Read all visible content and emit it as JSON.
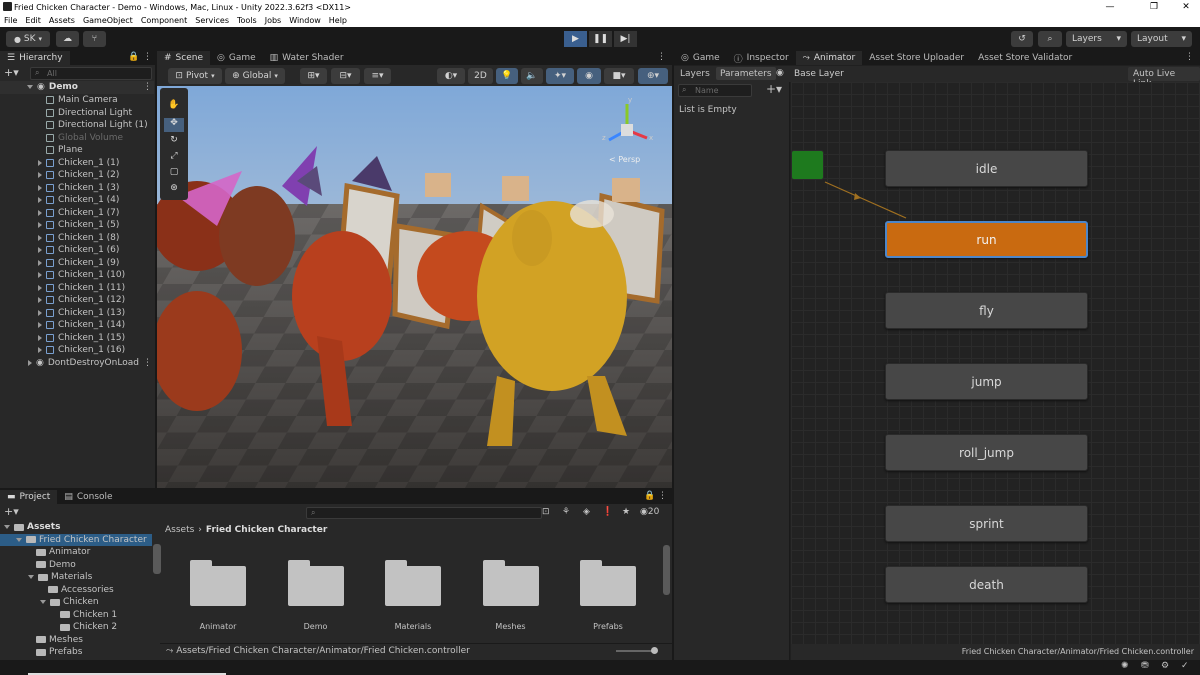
{
  "window": {
    "title": "Fried Chicken Character - Demo - Windows, Mac, Linux - Unity 2022.3.62f3 <DX11>"
  },
  "menu": [
    "File",
    "Edit",
    "Assets",
    "GameObject",
    "Component",
    "Services",
    "Tools",
    "Jobs",
    "Window",
    "Help"
  ],
  "toolbar": {
    "account": "SK",
    "layers": "Layers",
    "layout": "Layout"
  },
  "hierarchy": {
    "tab": "Hierarchy",
    "search_placeholder": "All",
    "scene": "Demo",
    "items": [
      {
        "label": "Main Camera",
        "kind": "object"
      },
      {
        "label": "Directional Light",
        "kind": "object"
      },
      {
        "label": "Directional Light (1)",
        "kind": "object"
      },
      {
        "label": "Global Volume",
        "kind": "disabled"
      },
      {
        "label": "Plane",
        "kind": "object"
      },
      {
        "label": "Chicken_1 (1)",
        "kind": "prefab"
      },
      {
        "label": "Chicken_1 (2)",
        "kind": "prefab"
      },
      {
        "label": "Chicken_1 (3)",
        "kind": "prefab"
      },
      {
        "label": "Chicken_1 (4)",
        "kind": "prefab"
      },
      {
        "label": "Chicken_1 (7)",
        "kind": "prefab"
      },
      {
        "label": "Chicken_1 (5)",
        "kind": "prefab"
      },
      {
        "label": "Chicken_1 (8)",
        "kind": "prefab"
      },
      {
        "label": "Chicken_1 (6)",
        "kind": "prefab"
      },
      {
        "label": "Chicken_1 (9)",
        "kind": "prefab"
      },
      {
        "label": "Chicken_1 (10)",
        "kind": "prefab"
      },
      {
        "label": "Chicken_1 (11)",
        "kind": "prefab"
      },
      {
        "label": "Chicken_1 (12)",
        "kind": "prefab"
      },
      {
        "label": "Chicken_1 (13)",
        "kind": "prefab"
      },
      {
        "label": "Chicken_1 (14)",
        "kind": "prefab"
      },
      {
        "label": "Chicken_1 (15)",
        "kind": "prefab"
      },
      {
        "label": "Chicken_1 (16)",
        "kind": "prefab"
      }
    ],
    "dontdestroy": "DontDestroyOnLoad"
  },
  "scene_tabs": [
    "Scene",
    "Game",
    "Water Shader"
  ],
  "scene_toolbar": {
    "pivot": "Pivot",
    "global": "Global",
    "mode_2d": "2D"
  },
  "gizmo": {
    "persp": "< Persp",
    "axis_x": "x",
    "axis_y": "y",
    "axis_z": "z"
  },
  "right_tabs": [
    "Game",
    "Inspector",
    "Animator",
    "Asset Store Uploader",
    "Asset Store Validator"
  ],
  "animator": {
    "layers_tab": "Layers",
    "parameters_tab": "Parameters",
    "breadcrumb": "Base Layer",
    "auto_live": "Auto Live Link",
    "name_placeholder": "Name",
    "empty": "List is Empty",
    "states": [
      "idle",
      "run",
      "fly",
      "jump",
      "roll_jump",
      "sprint",
      "death"
    ],
    "default_state": "run",
    "footer": "Fried Chicken Character/Animator/Fried Chicken.controller"
  },
  "project": {
    "tabs": [
      "Project",
      "Console"
    ],
    "tree": [
      {
        "label": "Assets",
        "depth": 0,
        "bold": true
      },
      {
        "label": "Fried Chicken Character",
        "depth": 1,
        "selected": true
      },
      {
        "label": "Animator",
        "depth": 2
      },
      {
        "label": "Demo",
        "depth": 2
      },
      {
        "label": "Materials",
        "depth": 2
      },
      {
        "label": "Accessories",
        "depth": 3
      },
      {
        "label": "Chicken",
        "depth": 3
      },
      {
        "label": "Chicken 1",
        "depth": 4
      },
      {
        "label": "Chicken 2",
        "depth": 4
      },
      {
        "label": "Meshes",
        "depth": 2
      },
      {
        "label": "Prefabs",
        "depth": 2
      }
    ],
    "breadcrumb_root": "Assets",
    "breadcrumb_current": "Fried Chicken Character",
    "folders": [
      "Animator",
      "Demo",
      "Materials",
      "Meshes",
      "Prefabs"
    ],
    "count": "20",
    "path": "Assets/Fried Chicken Character/Animator/Fried Chicken.controller"
  },
  "colors": {
    "accent": "#4d86c8",
    "default_state": "#c96a10",
    "entry_state": "#1e7a1e"
  }
}
